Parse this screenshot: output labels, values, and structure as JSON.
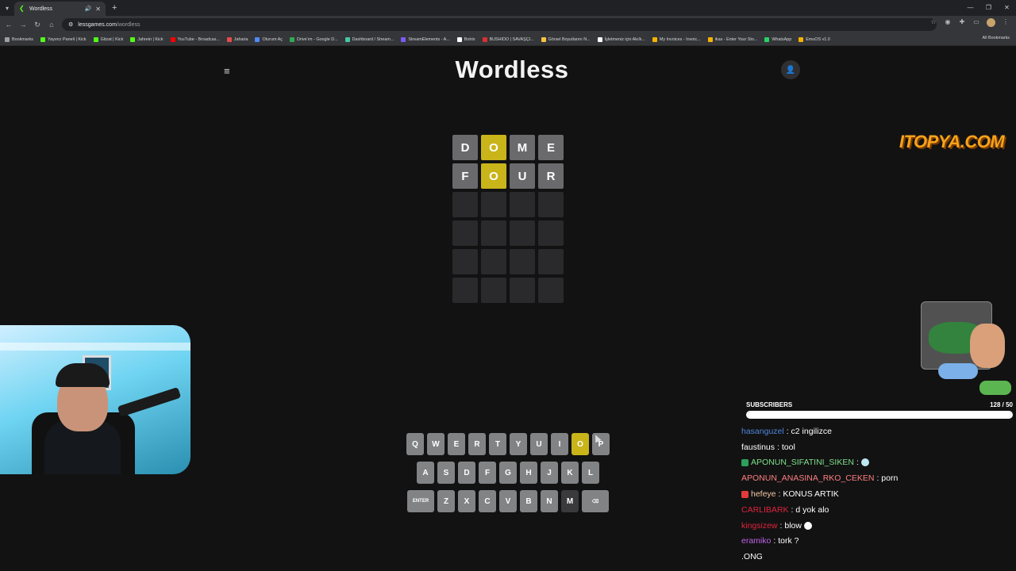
{
  "browser": {
    "tab_title": "Wordless",
    "url_host": "lessgames.com",
    "url_path": "/wordless",
    "bookmarks": [
      {
        "label": "Bookmarks",
        "color": "#9aa0a6"
      },
      {
        "label": "Yayıncı Paneli | Kick",
        "color": "#53fc18"
      },
      {
        "label": "Gitzat | Kick",
        "color": "#53fc18"
      },
      {
        "label": "Jahrein | Kick",
        "color": "#53fc18"
      },
      {
        "label": "YouTube - Broadcas...",
        "color": "#ff0000"
      },
      {
        "label": "Jaharia",
        "color": "#e84a4a"
      },
      {
        "label": "Oturum Aç",
        "color": "#4f8bf9"
      },
      {
        "label": "Drive'ım - Google D...",
        "color": "#34a853"
      },
      {
        "label": "Dashboard / Stream...",
        "color": "#45c6a5"
      },
      {
        "label": "StreamElements - A...",
        "color": "#7b5cf0"
      },
      {
        "label": "Botrix",
        "color": "#ffffff"
      },
      {
        "label": "BUSHIDO | SAVAŞÇI...",
        "color": "#d93030"
      },
      {
        "label": "Görsel Boyutlarını N...",
        "color": "#f5c542"
      },
      {
        "label": "İşletmeniz için Akıllı...",
        "color": "#ffffff"
      },
      {
        "label": "My Invoices - Invoic...",
        "color": "#f5b400"
      },
      {
        "label": "ikas - Enter Your Sto...",
        "color": "#f5b400"
      },
      {
        "label": "WhatsApp",
        "color": "#25d366"
      },
      {
        "label": "EmuOS v1.0",
        "color": "#f5b400"
      }
    ],
    "all_bookmarks": "All Bookmarks"
  },
  "game": {
    "logo": "Wordless",
    "board": [
      [
        {
          "l": "D",
          "s": "gray"
        },
        {
          "l": "O",
          "s": "yellow"
        },
        {
          "l": "M",
          "s": "gray"
        },
        {
          "l": "E",
          "s": "gray"
        }
      ],
      [
        {
          "l": "F",
          "s": "gray"
        },
        {
          "l": "O",
          "s": "yellow"
        },
        {
          "l": "U",
          "s": "gray"
        },
        {
          "l": "R",
          "s": "gray"
        }
      ],
      [
        {
          "l": "",
          "s": "empty"
        },
        {
          "l": "",
          "s": "empty"
        },
        {
          "l": "",
          "s": "empty"
        },
        {
          "l": "",
          "s": "empty"
        }
      ],
      [
        {
          "l": "",
          "s": "empty"
        },
        {
          "l": "",
          "s": "empty"
        },
        {
          "l": "",
          "s": "empty"
        },
        {
          "l": "",
          "s": "empty"
        }
      ],
      [
        {
          "l": "",
          "s": "empty"
        },
        {
          "l": "",
          "s": "empty"
        },
        {
          "l": "",
          "s": "empty"
        },
        {
          "l": "",
          "s": "empty"
        }
      ],
      [
        {
          "l": "",
          "s": "empty"
        },
        {
          "l": "",
          "s": "empty"
        },
        {
          "l": "",
          "s": "empty"
        },
        {
          "l": "",
          "s": "empty"
        }
      ]
    ],
    "keyboard": [
      [
        {
          "k": "Q"
        },
        {
          "k": "W"
        },
        {
          "k": "E"
        },
        {
          "k": "R"
        },
        {
          "k": "T"
        },
        {
          "k": "Y"
        },
        {
          "k": "U"
        },
        {
          "k": "I"
        },
        {
          "k": "O",
          "s": "yellow"
        },
        {
          "k": "P"
        }
      ],
      [
        {
          "k": "A"
        },
        {
          "k": "S"
        },
        {
          "k": "D"
        },
        {
          "k": "F"
        },
        {
          "k": "G"
        },
        {
          "k": "H"
        },
        {
          "k": "J"
        },
        {
          "k": "K"
        },
        {
          "k": "L"
        }
      ],
      [
        {
          "k": "ENTER",
          "w": true
        },
        {
          "k": "Z"
        },
        {
          "k": "X"
        },
        {
          "k": "C"
        },
        {
          "k": "V"
        },
        {
          "k": "B"
        },
        {
          "k": "N"
        },
        {
          "k": "M",
          "s": "dark"
        },
        {
          "k": "⌫",
          "w": true
        }
      ]
    ]
  },
  "overlay": {
    "brand": "ITOPYA.COM",
    "subs_label": "SUBSCRIBERS",
    "subs_count": "128 / 50",
    "subs_progress": 1.0,
    "chat": [
      {
        "user": "hasanguzel",
        "color": "#4f86d9",
        "text": ": c2 ingilizce"
      },
      {
        "user": "faustinus",
        "color": "#ffffff",
        "text": ": tool"
      },
      {
        "user": "APONUN_SIFATINI_SIKEN",
        "color": "#7ee08a",
        "text": " :",
        "badge": "#2e9e5b",
        "emote": "#bfe7f0"
      },
      {
        "user": "APONUN_ANASINA_RKO_CEKEN",
        "color": "#ff7f7f",
        "text": ": porn"
      },
      {
        "user": "hefeye",
        "color": "#f5c6a0",
        "text": ": KONUS ARTIK",
        "badge": "#e23a3a"
      },
      {
        "user": "CARLIBARK",
        "color": "#e0243a",
        "text": ": d yok alo"
      },
      {
        "user": "kingsizew",
        "color": "#e0243a",
        "text": ": blow",
        "emote": "#ffffff"
      },
      {
        "user": "eramiko",
        "color": "#c064e8",
        "text": ": tork ?"
      },
      {
        "user": "",
        "color": "#ffffff",
        "text": ".ONG"
      }
    ]
  },
  "colors": {
    "tile_gray": "#6a6a6c",
    "tile_yellow": "#c9b41a",
    "key_gray": "#818384"
  }
}
